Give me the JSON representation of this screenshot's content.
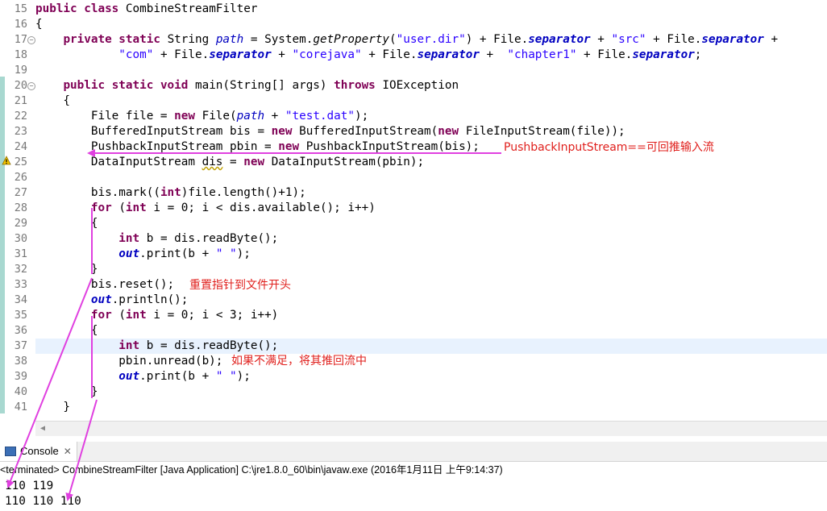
{
  "editor": {
    "lines": [
      {
        "n": "15",
        "code": [
          {
            "t": "public class ",
            "c": "kw"
          },
          {
            "t": "CombineStreamFilter"
          }
        ]
      },
      {
        "n": "16",
        "code": [
          {
            "t": "{"
          }
        ]
      },
      {
        "n": "17",
        "fold": true,
        "code": [
          {
            "t": "    "
          },
          {
            "t": "private static ",
            "c": "kw"
          },
          {
            "t": "String "
          },
          {
            "t": "path",
            "c": "sfld"
          },
          {
            "t": " = System."
          },
          {
            "t": "getProperty",
            "c": "ital"
          },
          {
            "t": "("
          },
          {
            "t": "\"user.dir\"",
            "c": "str"
          },
          {
            "t": ") + File."
          },
          {
            "t": "separator",
            "c": "fld"
          },
          {
            "t": " + "
          },
          {
            "t": "\"src\"",
            "c": "str"
          },
          {
            "t": " + File."
          },
          {
            "t": "separator",
            "c": "fld"
          },
          {
            "t": " +"
          }
        ]
      },
      {
        "n": "18",
        "code": [
          {
            "t": "            "
          },
          {
            "t": "\"com\"",
            "c": "str"
          },
          {
            "t": " + File."
          },
          {
            "t": "separator",
            "c": "fld"
          },
          {
            "t": " + "
          },
          {
            "t": "\"corejava\"",
            "c": "str"
          },
          {
            "t": " + File."
          },
          {
            "t": "separator",
            "c": "fld"
          },
          {
            "t": " +  "
          },
          {
            "t": "\"chapter1\"",
            "c": "str"
          },
          {
            "t": " + File."
          },
          {
            "t": "separator",
            "c": "fld"
          },
          {
            "t": ";"
          }
        ]
      },
      {
        "n": "19",
        "code": []
      },
      {
        "n": "20",
        "fold": true,
        "code": [
          {
            "t": "    "
          },
          {
            "t": "public static void ",
            "c": "kw"
          },
          {
            "t": "main(String[] args) "
          },
          {
            "t": "throws ",
            "c": "kw"
          },
          {
            "t": "IOException"
          }
        ]
      },
      {
        "n": "21",
        "code": [
          {
            "t": "    {"
          }
        ]
      },
      {
        "n": "22",
        "code": [
          {
            "t": "        File file = "
          },
          {
            "t": "new ",
            "c": "kw"
          },
          {
            "t": "File("
          },
          {
            "t": "path",
            "c": "sfld"
          },
          {
            "t": " + "
          },
          {
            "t": "\"test.dat\"",
            "c": "str"
          },
          {
            "t": ");"
          }
        ]
      },
      {
        "n": "23",
        "code": [
          {
            "t": "        BufferedInputStream bis = "
          },
          {
            "t": "new ",
            "c": "kw"
          },
          {
            "t": "BufferedInputStream("
          },
          {
            "t": "new ",
            "c": "kw"
          },
          {
            "t": "FileInputStream(file));"
          }
        ]
      },
      {
        "n": "24",
        "code": [
          {
            "t": "        PushbackInputStream pbin = "
          },
          {
            "t": "new ",
            "c": "kw"
          },
          {
            "t": "PushbackInputStream(bis);"
          }
        ]
      },
      {
        "n": "25",
        "warn": true,
        "code": [
          {
            "t": "        DataInputStream "
          },
          {
            "t": "dis",
            "c": "warn-var"
          },
          {
            "t": " = "
          },
          {
            "t": "new ",
            "c": "kw"
          },
          {
            "t": "DataInputStream(pbin);"
          }
        ]
      },
      {
        "n": "26",
        "code": []
      },
      {
        "n": "27",
        "code": [
          {
            "t": "        bis.mark(("
          },
          {
            "t": "int",
            "c": "kw"
          },
          {
            "t": ")file.length()+1);"
          }
        ]
      },
      {
        "n": "28",
        "code": [
          {
            "t": "        "
          },
          {
            "t": "for ",
            "c": "kw"
          },
          {
            "t": "("
          },
          {
            "t": "int ",
            "c": "kw"
          },
          {
            "t": "i = 0; i < dis.available(); i++)"
          }
        ]
      },
      {
        "n": "29",
        "code": [
          {
            "t": "        {"
          }
        ]
      },
      {
        "n": "30",
        "code": [
          {
            "t": "            "
          },
          {
            "t": "int ",
            "c": "kw"
          },
          {
            "t": "b = dis.readByte();"
          }
        ]
      },
      {
        "n": "31",
        "code": [
          {
            "t": "            "
          },
          {
            "t": "out",
            "c": "fld"
          },
          {
            "t": ".print(b + "
          },
          {
            "t": "\" \"",
            "c": "str"
          },
          {
            "t": ");"
          }
        ]
      },
      {
        "n": "32",
        "code": [
          {
            "t": "        }"
          }
        ]
      },
      {
        "n": "33",
        "code": [
          {
            "t": "        bis.reset();"
          }
        ]
      },
      {
        "n": "34",
        "code": [
          {
            "t": "        "
          },
          {
            "t": "out",
            "c": "fld"
          },
          {
            "t": ".println();"
          }
        ]
      },
      {
        "n": "35",
        "code": [
          {
            "t": "        "
          },
          {
            "t": "for ",
            "c": "kw"
          },
          {
            "t": "("
          },
          {
            "t": "int ",
            "c": "kw"
          },
          {
            "t": "i = 0; i < 3; i++)"
          }
        ]
      },
      {
        "n": "36",
        "code": [
          {
            "t": "        {"
          }
        ]
      },
      {
        "n": "37",
        "cur": true,
        "code": [
          {
            "t": "            "
          },
          {
            "t": "int ",
            "c": "kw"
          },
          {
            "t": "b = dis.readByte();"
          }
        ]
      },
      {
        "n": "38",
        "code": [
          {
            "t": "            pbin.unread(b);"
          }
        ]
      },
      {
        "n": "39",
        "code": [
          {
            "t": "            "
          },
          {
            "t": "out",
            "c": "fld"
          },
          {
            "t": ".print(b + "
          },
          {
            "t": "\" \"",
            "c": "str"
          },
          {
            "t": ");"
          }
        ]
      },
      {
        "n": "40",
        "code": [
          {
            "t": "        }"
          }
        ]
      },
      {
        "n": "41",
        "code": [
          {
            "t": "    }"
          }
        ]
      }
    ]
  },
  "annotations": {
    "pushback_note": "PushbackInputStream==可回推输入流",
    "reset_note": "重置指针到文件开头",
    "unread_note": "如果不满足，将其推回流中"
  },
  "console": {
    "tab_label": "Console",
    "tab_close": "✕",
    "header": "<terminated> CombineStreamFilter [Java Application] C:\\jre1.8.0_60\\bin\\javaw.exe (2016年1月11日 上午9:14:37)",
    "output": [
      "110 119",
      "110 110 110"
    ]
  },
  "colors": {
    "annotation": "#e0201d",
    "arrow": "#e040e0",
    "keyword": "#7f0055",
    "string": "#2a00ff",
    "field": "#0000c0"
  }
}
